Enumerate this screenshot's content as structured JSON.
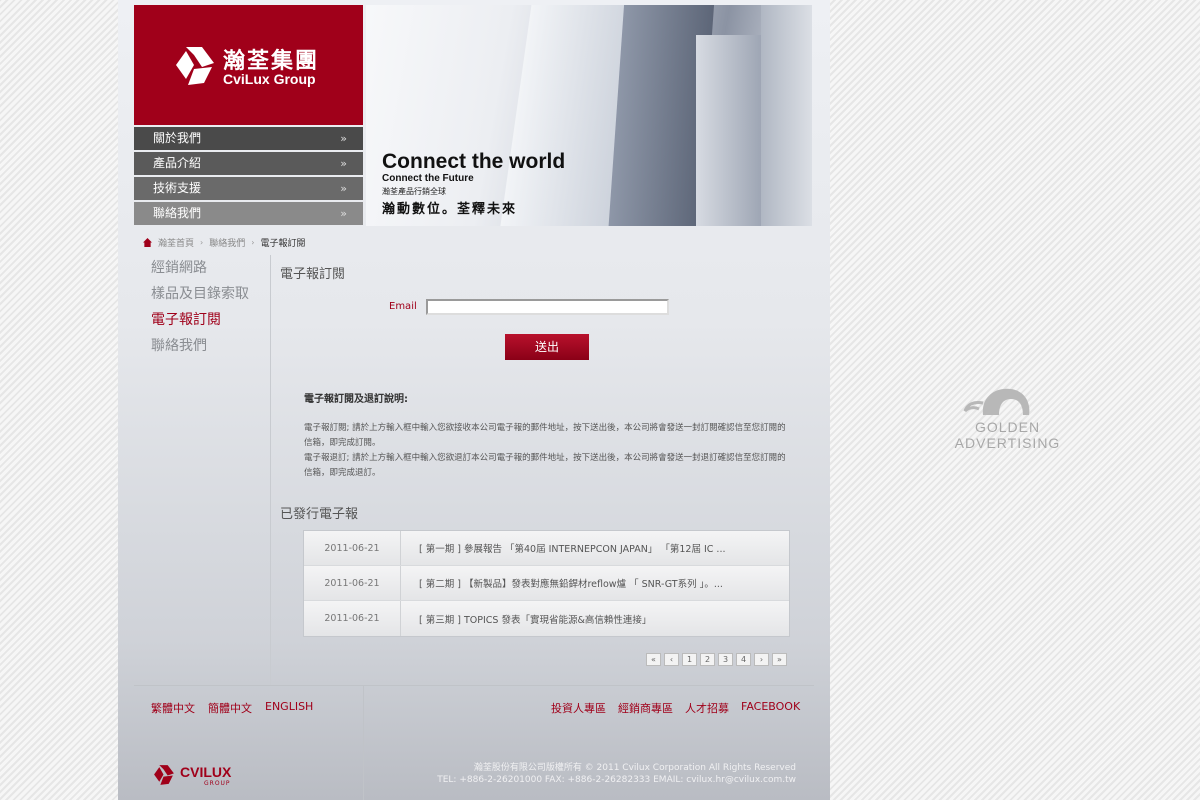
{
  "brand": {
    "name_cn": "瀚荃集團",
    "name_en": "CviLux Group",
    "color": "#a0001a"
  },
  "hero": {
    "title": "Connect the world",
    "subtitle": "Connect the Future",
    "cn_line1": "瀚荃產品行銷全球",
    "cn_line2": "瀚動數位。荃釋未來"
  },
  "top_nav": [
    {
      "label": "關於我們",
      "icon": "double-chevron-icon",
      "bg": "#4a4a4a"
    },
    {
      "label": "產品介紹",
      "icon": "double-chevron-icon",
      "bg": "#5a5a5a"
    },
    {
      "label": "技術支援",
      "icon": "double-chevron-icon",
      "bg": "#6a6a6a"
    },
    {
      "label": "聯絡我們",
      "icon": "double-chevron-icon",
      "bg": "#8a8a8a"
    }
  ],
  "breadcrumb": {
    "home_icon": "home-icon",
    "items": [
      "瀚荃首頁",
      "聯絡我們",
      "電子報訂閱"
    ]
  },
  "sub_nav": [
    {
      "label": "經銷網路",
      "active": false
    },
    {
      "label": "樣品及目錄索取",
      "active": false
    },
    {
      "label": "電子報訂閱",
      "active": true
    },
    {
      "label": "聯絡我們",
      "active": false
    }
  ],
  "main": {
    "section_title": "電子報訂閱",
    "email_label": "Email",
    "email_value": "",
    "submit_label": "送出",
    "instructions_title": "電子報訂閱及退訂說明:",
    "instructions": [
      "電子報訂閱; 請於上方輸入框中輸入您欲接收本公司電子報的郵件地址，按下送出後，本公司將會發送一封訂閱確認信至您訂閱的信箱，即完成訂閱。",
      "電子報退訂; 請於上方輸入框中輸入您欲退訂本公司電子報的郵件地址，按下送出後，本公司將會發送一封退訂確認信至您訂閱的信箱，即完成退訂。"
    ],
    "published_title": "已發行電子報",
    "issues": [
      {
        "date": "2011-06-21",
        "title": "[ 第一期 ] 參展報告 「第40屆 INTERNEPCON JAPAN」 「第12屆 IC ..."
      },
      {
        "date": "2011-06-21",
        "title": "[ 第二期 ] 【新製品】發表對應無鉛銲材reflow爐 「 SNR-GT系列 」。..."
      },
      {
        "date": "2011-06-21",
        "title": "[ 第三期 ] TOPICS 發表「實現省能源&高信賴性連接」"
      }
    ],
    "pagination": {
      "first": "«",
      "prev": "‹",
      "pages": [
        "1",
        "2",
        "3",
        "4"
      ],
      "next": "›",
      "last": "»"
    }
  },
  "footer": {
    "languages": [
      "繁體中文",
      "簡體中文",
      "ENGLISH"
    ],
    "links": [
      "投資人專區",
      "經銷商專區",
      "人才招募",
      "FACEBOOK"
    ],
    "copyright": "瀚荃股份有限公司版權所有 © 2011 Cvilux Corporation All Rights Reserved",
    "contact": "TEL: +886-2-26201000    FAX: +886-2-26282333    EMAIL: cvilux.hr@cvilux.com.tw",
    "logo_text": "CVILUX",
    "logo_sub": "GROUP"
  },
  "watermark": {
    "text": "GOLDEN ADVERTISING",
    "icon": "elephant-icon"
  }
}
